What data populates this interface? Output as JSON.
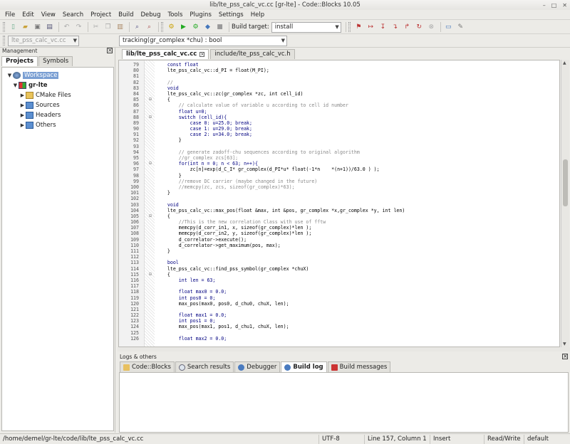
{
  "window": {
    "title": "lib/lte_pss_calc_vc.cc [gr-lte] - Code::Blocks 10.05"
  },
  "menu": [
    "File",
    "Edit",
    "View",
    "Search",
    "Project",
    "Build",
    "Debug",
    "Tools",
    "Plugins",
    "Settings",
    "Help"
  ],
  "toolbar": {
    "build_target_label": "Build target:",
    "build_target_value": "install"
  },
  "toolbar2": {
    "scope_value": "lte_pss_calc_vc.cc",
    "symbol_value": "tracking(gr_complex *chu) : bool"
  },
  "management": {
    "title": "Management",
    "tabs": [
      "Projects",
      "Symbols"
    ],
    "tree": {
      "workspace": "Workspace",
      "project": "gr-lte",
      "folders": [
        "CMake Files",
        "Sources",
        "Headers",
        "Others"
      ]
    }
  },
  "editor": {
    "tabs": [
      "lib/lte_pss_calc_vc.cc",
      "include/lte_pss_calc_vc.h"
    ],
    "lines": [
      {
        "n": "79",
        "f": "",
        "t": "    const float"
      },
      {
        "n": "80",
        "f": "",
        "t": "    lte_pss_calc_vc::d_PI = float(M_PI);"
      },
      {
        "n": "81",
        "f": "",
        "t": ""
      },
      {
        "n": "82",
        "f": "",
        "t": "    //"
      },
      {
        "n": "83",
        "f": "",
        "t": "    void"
      },
      {
        "n": "84",
        "f": "",
        "t": "    lte_pss_calc_vc::zc(gr_complex *zc, int cell_id)"
      },
      {
        "n": "85",
        "f": "⊟",
        "t": "    {"
      },
      {
        "n": "86",
        "f": "",
        "t": "        // calculate value of variable u according to cell id number"
      },
      {
        "n": "87",
        "f": "",
        "t": "        float u=0;"
      },
      {
        "n": "88",
        "f": "⊟",
        "t": "        switch (cell_id){"
      },
      {
        "n": "89",
        "f": "",
        "t": "            case 0: u=25.0; break;"
      },
      {
        "n": "90",
        "f": "",
        "t": "            case 1: u=29.0; break;"
      },
      {
        "n": "91",
        "f": "",
        "t": "            case 2: u=34.0; break;"
      },
      {
        "n": "92",
        "f": "",
        "t": "        }"
      },
      {
        "n": "93",
        "f": "",
        "t": ""
      },
      {
        "n": "94",
        "f": "",
        "t": "        // generate zadoff-chu sequences according to original algorithm"
      },
      {
        "n": "95",
        "f": "",
        "t": "        //gr_complex zcs[63];"
      },
      {
        "n": "96",
        "f": "⊟",
        "t": "        for(int n = 0; n < 63; n++){"
      },
      {
        "n": "97",
        "f": "",
        "t": "            zc[n]=exp(d_C_I* gr_complex(d_PI*u* float(-1*n    *(n+1))/63.0 ) );"
      },
      {
        "n": "98",
        "f": "",
        "t": "        }"
      },
      {
        "n": "99",
        "f": "",
        "t": "        //remove DC carrier (maybe changed in the future)"
      },
      {
        "n": "100",
        "f": "",
        "t": "        //memcpy(zc, zcs, sizeof(gr_complex)*63);"
      },
      {
        "n": "101",
        "f": "",
        "t": "    }"
      },
      {
        "n": "102",
        "f": "",
        "t": ""
      },
      {
        "n": "103",
        "f": "",
        "t": "    void"
      },
      {
        "n": "104",
        "f": "",
        "t": "    lte_pss_calc_vc::max_pos(float &max, int &pos, gr_complex *x,gr_complex *y, int len)"
      },
      {
        "n": "105",
        "f": "⊟",
        "t": "    {"
      },
      {
        "n": "106",
        "f": "",
        "t": "        //This is the new correlation Class with use of fftw"
      },
      {
        "n": "107",
        "f": "",
        "t": "        memcpy(d_corr_in1, x, sizeof(gr_complex)*len );"
      },
      {
        "n": "108",
        "f": "",
        "t": "        memcpy(d_corr_in2, y, sizeof(gr_complex)*len );"
      },
      {
        "n": "109",
        "f": "",
        "t": "        d_correlator->execute();"
      },
      {
        "n": "110",
        "f": "",
        "t": "        d_correlator->get_maximum(pos, max);"
      },
      {
        "n": "111",
        "f": "",
        "t": "    }"
      },
      {
        "n": "112",
        "f": "",
        "t": ""
      },
      {
        "n": "113",
        "f": "",
        "t": "    bool"
      },
      {
        "n": "114",
        "f": "",
        "t": "    lte_pss_calc_vc::find_pss_symbol(gr_complex *chuX)"
      },
      {
        "n": "115",
        "f": "⊟",
        "t": "    {"
      },
      {
        "n": "116",
        "f": "",
        "t": "        int len = 63;"
      },
      {
        "n": "117",
        "f": "",
        "t": ""
      },
      {
        "n": "118",
        "f": "",
        "t": "        float max0 = 0.0;"
      },
      {
        "n": "119",
        "f": "",
        "t": "        int pos0 = 0;"
      },
      {
        "n": "120",
        "f": "",
        "t": "        max_pos(max0, pos0, d_chu0, chuX, len);"
      },
      {
        "n": "121",
        "f": "",
        "t": ""
      },
      {
        "n": "122",
        "f": "",
        "t": "        float max1 = 0.0;"
      },
      {
        "n": "123",
        "f": "",
        "t": "        int pos1 = 0;"
      },
      {
        "n": "124",
        "f": "",
        "t": "        max_pos(max1, pos1, d_chu1, chuX, len);"
      },
      {
        "n": "125",
        "f": "",
        "t": ""
      },
      {
        "n": "126",
        "f": "",
        "t": "        float max2 = 0.0;"
      }
    ]
  },
  "logs": {
    "title": "Logs & others",
    "tabs": [
      "Code::Blocks",
      "Search results",
      "Debugger",
      "Build log",
      "Build messages"
    ],
    "active": "Build log"
  },
  "status": {
    "path": "/home/demel/gr-lte/code/lib/lte_pss_calc_vc.cc",
    "encoding": "UTF-8",
    "position": "Line 157, Column 1",
    "mode": "Insert",
    "access": "Read/Write",
    "profile": "default"
  },
  "colors": {
    "accent": "#4a7bbf",
    "workspace_highlight": "#7a9fd3"
  }
}
